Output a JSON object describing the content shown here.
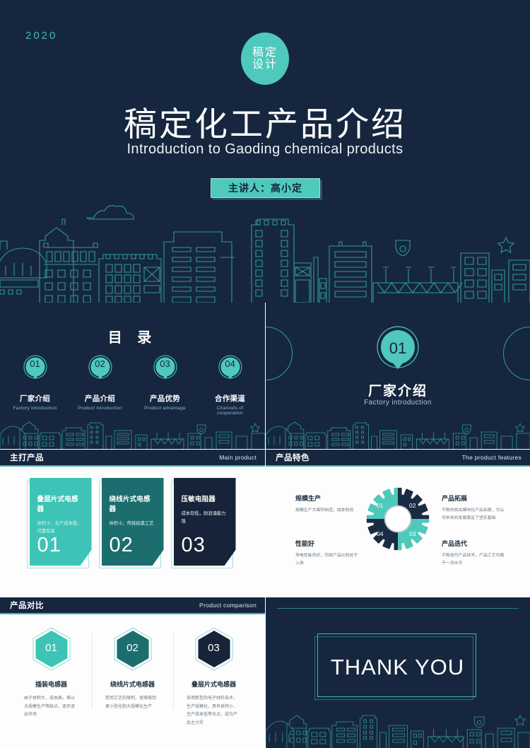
{
  "theme": {
    "navy": "#16263f",
    "teal": "#4ec9bc",
    "deep_teal": "#1e7a78",
    "dark_card": "#172338",
    "white": "#ffffff"
  },
  "cover": {
    "year": "2020",
    "logo_line1": "稿定",
    "logo_line2": "设计",
    "title": "稿定化工产品介绍",
    "subtitle": "Introduction to Gaoding chemical products",
    "speaker": "主讲人：高小定"
  },
  "toc": {
    "title": "目 录",
    "items": [
      {
        "num": "01",
        "cn": "厂家介绍",
        "en": "Factory introduction"
      },
      {
        "num": "02",
        "cn": "产品介绍",
        "en": "Product introduction"
      },
      {
        "num": "03",
        "cn": "产品优势",
        "en": "Product advantage"
      },
      {
        "num": "04",
        "cn": "合作渠道",
        "en": "Channels of cooperation"
      }
    ]
  },
  "section": {
    "num": "01",
    "cn": "厂家介绍",
    "en": "Factory introduction"
  },
  "main_product": {
    "header_cn": "主打产品",
    "header_en": "Main product",
    "cards": [
      {
        "num": "01",
        "title": "叠层片式电感器",
        "desc": "体积小、生产成本低、可靠性高",
        "color": "#3ec4b6"
      },
      {
        "num": "02",
        "title": "绕线片式电感器",
        "desc": "体积小、传统经典工艺",
        "color": "#1c6e6e"
      },
      {
        "num": "03",
        "title": "压敏电阻器",
        "desc": "成本较低，耐浪涌能力强",
        "color": "#172338"
      }
    ]
  },
  "features": {
    "header_cn": "产品特色",
    "header_en": "The product features",
    "gear_numbers": [
      "01",
      "02",
      "03",
      "04"
    ],
    "items": [
      {
        "num": "01",
        "title": "规模生产",
        "desc": "规模生产大面积制造，成本较低"
      },
      {
        "num": "02",
        "title": "产品拓展",
        "desc": "不断向相关模块化产品拓展，为公司未来的发展奠定了坚实基础"
      },
      {
        "num": "04",
        "title": "性能好",
        "desc": "导电性能良好，同类产品比较处于上游"
      },
      {
        "num": "03",
        "title": "产品迭代",
        "desc": "不断迭代产品技术，产品工艺均属于一流水平"
      }
    ]
  },
  "comparison": {
    "header_cn": "产品对比",
    "header_en": "Product comparison",
    "columns": [
      {
        "num": "01",
        "title": "插装电感器",
        "desc": "由于体积大、成本高，难以大规模生产等缺点，逐步退出市场",
        "color": "#3ec4b6"
      },
      {
        "num": "02",
        "title": "绕线片式电感器",
        "desc": "受到工艺的限制，很难做到更小型化和大规模化生产",
        "color": "#1c6e6e"
      },
      {
        "num": "03",
        "title": "叠层片式电感器",
        "desc": "采用新型的电子材料技术，生产规模化，具有体积小、生产成本低等优点，成为产品主力军",
        "color": "#172338"
      }
    ]
  },
  "thanks": {
    "text": "THANK YOU"
  }
}
